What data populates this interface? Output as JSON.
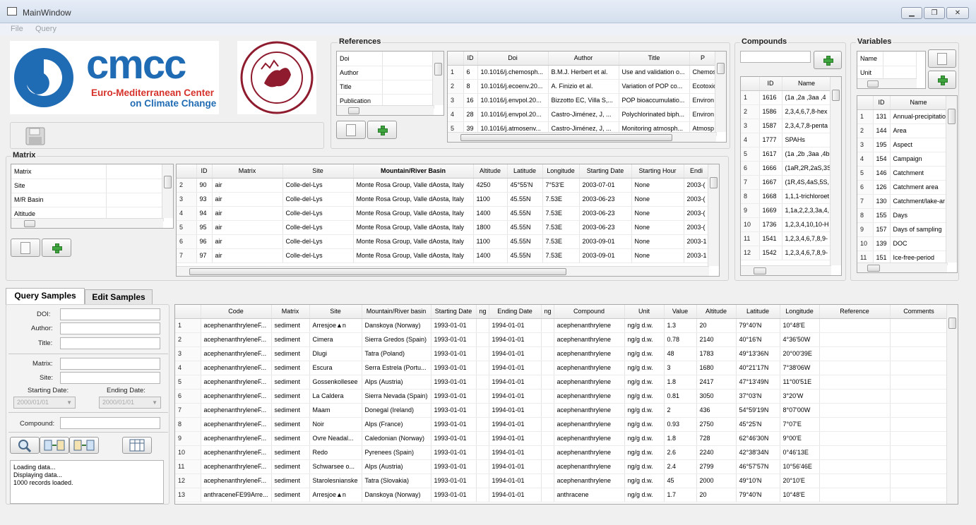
{
  "window": {
    "title": "MainWindow",
    "min": "▁",
    "max": "❐",
    "close": "✕"
  },
  "menu": [
    "File",
    "Query"
  ],
  "logo_cmcc": {
    "text": "cmcc",
    "line1": "Euro-Mediterranean Center",
    "line2": "on Climate Change"
  },
  "logo_seal": {
    "text": "VENETIARUM UNIVERSITAS · IN DOMO FOSCARI"
  },
  "references": {
    "title": "References",
    "fields": [
      "Doi",
      "Author",
      "Title",
      "Publication"
    ],
    "columns": [
      "ID",
      "Doi",
      "Author",
      "Title",
      "P"
    ],
    "rows": [
      [
        "1",
        "6",
        "10.1016/j.chemosph...",
        "B.M.J. Herbert et al.",
        "Use and validation o...",
        "Chemos"
      ],
      [
        "2",
        "8",
        "10.1016/j.ecoenv.20...",
        "A. Finizio et al.",
        "Variation of POP co...",
        "Ecotoxic"
      ],
      [
        "3",
        "16",
        "10.1016/j.envpol.20...",
        "Bizzotto EC, Villa S,...",
        "POP bioaccumulatio...",
        "Environ"
      ],
      [
        "4",
        "28",
        "10.1016/j.envpol.20...",
        "Castro-Jiménez, J, ...",
        "Polychlorinated biph...",
        "Environ"
      ],
      [
        "5",
        "39",
        "10.1016/j.atmosenv...",
        "Castro-Jiménez, J, ...",
        "Monitoring atmosph...",
        "Atmosp"
      ]
    ]
  },
  "compounds": {
    "title": "Compounds",
    "columns": [
      "ID",
      "Name"
    ],
    "rows": [
      [
        "1",
        "1616",
        "(1a ,2a ,3aa ,4"
      ],
      [
        "2",
        "1586",
        "2,3,4,6,7,8-hex"
      ],
      [
        "3",
        "1587",
        "2,3,4,7,8-penta"
      ],
      [
        "4",
        "1777",
        "SPAHs"
      ],
      [
        "5",
        "1617",
        "(1a ,2b ,3aa ,4b"
      ],
      [
        "6",
        "1666",
        "(1aR,2R,2aS,3S"
      ],
      [
        "7",
        "1667",
        "(1R,4S,4aS,5S,"
      ],
      [
        "8",
        "1668",
        "1,1,1-trichloroet"
      ],
      [
        "9",
        "1669",
        "1,1a,2,2,3,3a,4,"
      ],
      [
        "10",
        "1736",
        "1,2,3,4,10,10-H"
      ],
      [
        "11",
        "1541",
        "1,2,3,4,6,7,8,9-"
      ],
      [
        "12",
        "1542",
        "1,2,3,4,6,7,8,9-"
      ]
    ]
  },
  "variables": {
    "title": "Variables",
    "fields": [
      "Name",
      "Unit"
    ],
    "columns": [
      "ID",
      "Name"
    ],
    "rows": [
      [
        "1",
        "131",
        "Annual-precipitatio"
      ],
      [
        "2",
        "144",
        "Area"
      ],
      [
        "3",
        "195",
        "Aspect"
      ],
      [
        "4",
        "154",
        "Campaign"
      ],
      [
        "5",
        "146",
        "Catchment"
      ],
      [
        "6",
        "126",
        "Catchment area"
      ],
      [
        "7",
        "130",
        "Catchment/lake-ar"
      ],
      [
        "8",
        "155",
        "Days"
      ],
      [
        "9",
        "157",
        "Days of sampling"
      ],
      [
        "10",
        "139",
        "DOC"
      ],
      [
        "11",
        "151",
        "Ice-free-period"
      ]
    ]
  },
  "matrix": {
    "title": "Matrix",
    "fields": [
      "Matrix",
      "Site",
      "M/R Basin",
      "Altitude"
    ],
    "columns": [
      "ID",
      "Matrix",
      "Site",
      "Mountain/River Basin",
      "Altitude",
      "Latitude",
      "Longitude",
      "Starting Date",
      "Starting Hour",
      "Endi"
    ],
    "rows": [
      [
        "2",
        "90",
        "air",
        "Colle-del-Lys",
        "Monte Rosa Group, Valle dAosta, Italy",
        "4250",
        "45°55'N",
        "7°53'E",
        "2003-07-01",
        "None",
        "2003-("
      ],
      [
        "3",
        "93",
        "air",
        "Colle-del-Lys",
        "Monte Rosa Group, Valle dAosta, Italy",
        "1100",
        "45.55N",
        "7.53E",
        "2003-06-23",
        "None",
        "2003-("
      ],
      [
        "4",
        "94",
        "air",
        "Colle-del-Lys",
        "Monte Rosa Group, Valle dAosta, Italy",
        "1400",
        "45.55N",
        "7.53E",
        "2003-06-23",
        "None",
        "2003-("
      ],
      [
        "5",
        "95",
        "air",
        "Colle-del-Lys",
        "Monte Rosa Group, Valle dAosta, Italy",
        "1800",
        "45.55N",
        "7.53E",
        "2003-06-23",
        "None",
        "2003-("
      ],
      [
        "6",
        "96",
        "air",
        "Colle-del-Lys",
        "Monte Rosa Group, Valle dAosta, Italy",
        "1100",
        "45.55N",
        "7.53E",
        "2003-09-01",
        "None",
        "2003-1"
      ],
      [
        "7",
        "97",
        "air",
        "Colle-del-Lys",
        "Monte Rosa Group, Valle dAosta, Italy",
        "1400",
        "45.55N",
        "7.53E",
        "2003-09-01",
        "None",
        "2003-1"
      ]
    ]
  },
  "tabs": [
    "Query Samples",
    "Edit Samples"
  ],
  "query_form": {
    "doi": "DOI:",
    "author": "Author:",
    "title": "Title:",
    "matrix": "Matrix:",
    "site": "Site:",
    "start_label": "Starting Date:",
    "end_label": "Ending Date:",
    "start_value": "2000/01/01",
    "end_value": "2000/01/01",
    "compound": "Compound:"
  },
  "log": [
    "Loading data...",
    "Displaying data...",
    "1000 records loaded."
  ],
  "samples": {
    "columns": [
      "Code",
      "Matrix",
      "Site",
      "Mountain/River basin",
      "Starting Date",
      "ng",
      "Ending Date",
      "ng",
      "Compound",
      "Unit",
      "Value",
      "Altitude",
      "Latitude",
      "Longitude",
      "Reference",
      "Comments"
    ],
    "rows": [
      [
        "1",
        "acephenanthryleneF...",
        "sediment",
        "Arresjoe▲n",
        "Danskoya (Norway)",
        "1993-01-01",
        "",
        "1994-01-01",
        "",
        "acephenanthrylene",
        "ng/g d.w.",
        "1.3",
        "20",
        "79°40'N",
        "10°48'E",
        "",
        ""
      ],
      [
        "2",
        "acephenanthryleneF...",
        "sediment",
        "Cimera",
        "Sierra Gredos (Spain)",
        "1993-01-01",
        "",
        "1994-01-01",
        "",
        "acephenanthrylene",
        "ng/g d.w.",
        "0.78",
        "2140",
        "40°16'N",
        "4°36'50W",
        "",
        ""
      ],
      [
        "3",
        "acephenanthryleneF...",
        "sediment",
        "Dlugi",
        "Tatra (Poland)",
        "1993-01-01",
        "",
        "1994-01-01",
        "",
        "acephenanthrylene",
        "ng/g d.w.",
        "48",
        "1783",
        "49°13'36N",
        "20°00'39E",
        "",
        ""
      ],
      [
        "4",
        "acephenanthryleneF...",
        "sediment",
        "Escura",
        "Serra Estrela (Portu...",
        "1993-01-01",
        "",
        "1994-01-01",
        "",
        "acephenanthrylene",
        "ng/g d.w.",
        "3",
        "1680",
        "40°21'17N",
        "7°38'06W",
        "",
        ""
      ],
      [
        "5",
        "acephenanthryleneF...",
        "sediment",
        "Gossenkollesee",
        "Alps (Austria)",
        "1993-01-01",
        "",
        "1994-01-01",
        "",
        "acephenanthrylene",
        "ng/g d.w.",
        "1.8",
        "2417",
        "47°13'49N",
        "11°00'51E",
        "",
        ""
      ],
      [
        "6",
        "acephenanthryleneF...",
        "sediment",
        "La Caldera",
        "Sierra Nevada (Spain)",
        "1993-01-01",
        "",
        "1994-01-01",
        "",
        "acephenanthrylene",
        "ng/g d.w.",
        "0.81",
        "3050",
        "37°03'N",
        "3°20'W",
        "",
        ""
      ],
      [
        "7",
        "acephenanthryleneF...",
        "sediment",
        "Maam",
        "Donegal (Ireland)",
        "1993-01-01",
        "",
        "1994-01-01",
        "",
        "acephenanthrylene",
        "ng/g d.w.",
        "2",
        "436",
        "54°59'19N",
        "8°07'00W",
        "",
        ""
      ],
      [
        "8",
        "acephenanthryleneF...",
        "sediment",
        "Noir",
        "Alps (France)",
        "1993-01-01",
        "",
        "1994-01-01",
        "",
        "acephenanthrylene",
        "ng/g d.w.",
        "0.93",
        "2750",
        "45°25'N",
        "7°07'E",
        "",
        ""
      ],
      [
        "9",
        "acephenanthryleneF...",
        "sediment",
        "Ovre Neadal...",
        "Caledonian (Norway)",
        "1993-01-01",
        "",
        "1994-01-01",
        "",
        "acephenanthrylene",
        "ng/g d.w.",
        "1.8",
        "728",
        "62°46'30N",
        "9°00'E",
        "",
        ""
      ],
      [
        "10",
        "acephenanthryleneF...",
        "sediment",
        "Redo",
        "Pyrenees (Spain)",
        "1993-01-01",
        "",
        "1994-01-01",
        "",
        "acephenanthrylene",
        "ng/g d.w.",
        "2.6",
        "2240",
        "42°38'34N",
        "0°46'13E",
        "",
        ""
      ],
      [
        "11",
        "acephenanthryleneF...",
        "sediment",
        "Schwarsee o...",
        "Alps (Austria)",
        "1993-01-01",
        "",
        "1994-01-01",
        "",
        "acephenanthrylene",
        "ng/g d.w.",
        "2.4",
        "2799",
        "46°57'57N",
        "10°56'46E",
        "",
        ""
      ],
      [
        "12",
        "acephenanthryleneF...",
        "sediment",
        "Starolesnianske",
        "Tatra (Slovakia)",
        "1993-01-01",
        "",
        "1994-01-01",
        "",
        "acephenanthrylene",
        "ng/g d.w.",
        "45",
        "2000",
        "49°10'N",
        "20°10'E",
        "",
        ""
      ],
      [
        "13",
        "anthraceneFE99Arre...",
        "sediment",
        "Arresjoe▲n",
        "Danskoya (Norway)",
        "1993-01-01",
        "",
        "1994-01-01",
        "",
        "anthracene",
        "ng/g d.w.",
        "1.7",
        "20",
        "79°40'N",
        "10°48'E",
        "",
        ""
      ]
    ]
  },
  "colors": {
    "cmcc_blue": "#1f6bb4",
    "cmcc_red": "#d6322b",
    "seal_red": "#8e1b2e",
    "plus_green": "#3fa63f"
  }
}
